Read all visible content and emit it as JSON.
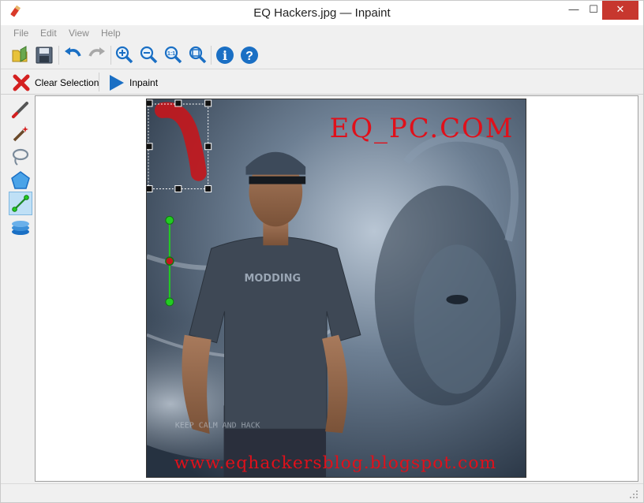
{
  "window": {
    "title": "EQ Hackers.jpg — Inpaint",
    "minimize_glyph": "—",
    "maximize_glyph": "☐",
    "close_glyph": "✕"
  },
  "menu": {
    "items": [
      {
        "label": "File"
      },
      {
        "label": "Edit"
      },
      {
        "label": "View"
      },
      {
        "label": "Help"
      }
    ]
  },
  "toolbar": {
    "buttons": [
      {
        "icon": "open-folder-icon"
      },
      {
        "icon": "save-icon"
      },
      {
        "icon": "undo-icon"
      },
      {
        "icon": "redo-icon"
      },
      {
        "icon": "zoom-in-icon"
      },
      {
        "icon": "zoom-out-icon"
      },
      {
        "icon": "zoom-actual-size-icon",
        "text": "1:1"
      },
      {
        "icon": "zoom-fit-icon"
      },
      {
        "icon": "info-icon",
        "text": "i"
      },
      {
        "icon": "help-icon",
        "text": "?"
      }
    ]
  },
  "actions": {
    "clear_selection": "Clear Selection",
    "inpaint": "Inpaint"
  },
  "tools": [
    {
      "icon": "marker-icon"
    },
    {
      "icon": "magic-wand-icon"
    },
    {
      "icon": "lasso-icon"
    },
    {
      "icon": "polygonal-lasso-icon"
    },
    {
      "icon": "guide-lines-icon",
      "active": true
    },
    {
      "icon": "layers-icon"
    }
  ],
  "image": {
    "watermark_top": "EQ_PC.COM",
    "watermark_bottom": "www.eqhackersblog.blogspot.com",
    "shirt_text": "MODDING",
    "bg_text": "KEEP CALM AND HACK"
  },
  "colors": {
    "accent_blue": "#1a6fc4",
    "watermark_red": "#e0101a",
    "guide_green": "#22cc22",
    "selection_red": "#c4161c"
  }
}
